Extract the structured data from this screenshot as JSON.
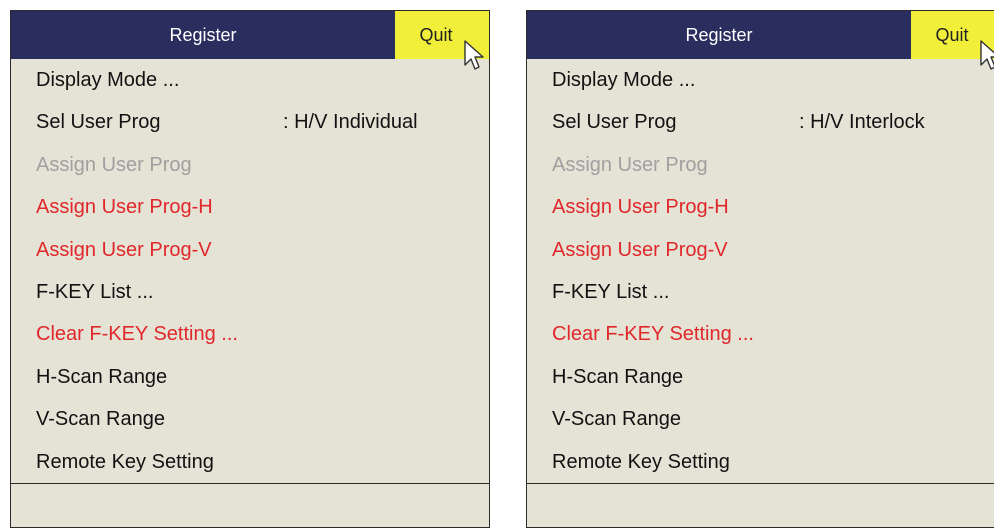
{
  "panels": [
    {
      "title": "Register",
      "quit_label": "Quit",
      "items": [
        {
          "label": "Display Mode ...",
          "value": "",
          "state": "normal"
        },
        {
          "label": "Sel User Prog",
          "value": ": H/V Individual",
          "state": "normal"
        },
        {
          "label": "Assign User Prog",
          "value": "",
          "state": "disabled"
        },
        {
          "label": "Assign User Prog-H",
          "value": "",
          "state": "red"
        },
        {
          "label": "Assign User Prog-V",
          "value": "",
          "state": "red"
        },
        {
          "label": "F-KEY List ...",
          "value": "",
          "state": "normal"
        },
        {
          "label": "Clear F-KEY Setting ...",
          "value": "",
          "state": "red"
        },
        {
          "label": "H-Scan Range",
          "value": "",
          "state": "normal"
        },
        {
          "label": "V-Scan Range",
          "value": "",
          "state": "normal"
        },
        {
          "label": "Remote Key Setting",
          "value": "",
          "state": "normal"
        }
      ]
    },
    {
      "title": "Register",
      "quit_label": "Quit",
      "items": [
        {
          "label": "Display Mode ...",
          "value": "",
          "state": "normal"
        },
        {
          "label": "Sel User Prog",
          "value": ": H/V Interlock",
          "state": "normal"
        },
        {
          "label": "Assign User Prog",
          "value": "",
          "state": "disabled"
        },
        {
          "label": "Assign User Prog-H",
          "value": "",
          "state": "red"
        },
        {
          "label": "Assign User Prog-V",
          "value": "",
          "state": "red"
        },
        {
          "label": "F-KEY List ...",
          "value": "",
          "state": "normal"
        },
        {
          "label": "Clear F-KEY Setting ...",
          "value": "",
          "state": "red"
        },
        {
          "label": "H-Scan Range",
          "value": "",
          "state": "normal"
        },
        {
          "label": "V-Scan Range",
          "value": "",
          "state": "normal"
        },
        {
          "label": "Remote Key Setting",
          "value": "",
          "state": "normal"
        }
      ]
    }
  ],
  "icons": {
    "cursor": "mouse-pointer-icon"
  },
  "colors": {
    "titlebar": "#2a2e5e",
    "quit_button": "#f2ef3b",
    "menu_background": "#e5e2d6",
    "disabled_text": "#a0a0a0",
    "red_text": "#e0282b"
  }
}
